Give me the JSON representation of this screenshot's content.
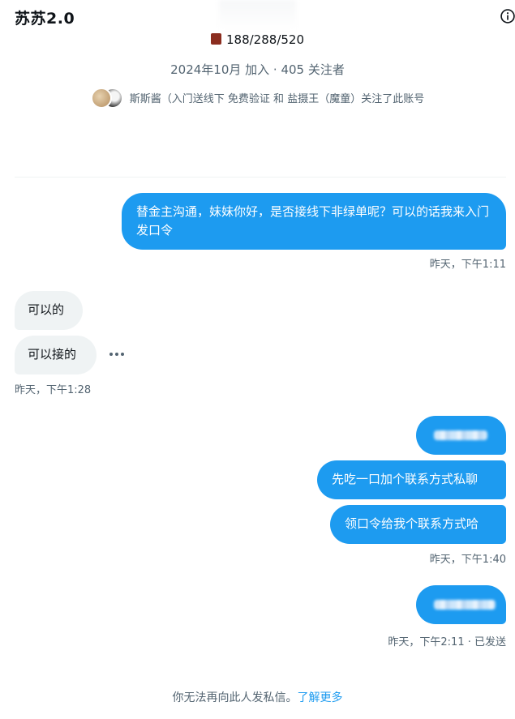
{
  "header": {
    "title": "苏苏2.0",
    "info_icon": "info-circle-icon"
  },
  "profile": {
    "stats": "188/288/520",
    "joined_followers": "2024年10月 加入 · 405 关注者",
    "followed_by": "斯斯酱（入门送线下 免费验证 和 盐摄王（魔童）关注了此账号"
  },
  "messages": {
    "m1_text": "替金主沟通，妹妹你好，是否接线下非绿单呢？可以的话我来入门发口令",
    "m1_time": "昨天，下午1:11",
    "r1_text": "可以的",
    "r2_text": "可以接的",
    "r_time": "昨天，下午1:28",
    "m3_text": "先吃一口加个联系方式私聊",
    "m4_text": "领口令给我个联系方式哈",
    "m_group_time": "昨天，下午1:40",
    "m5_time": "昨天，下午2:11 · 已发送"
  },
  "footer": {
    "text": "你无法再向此人发私信。",
    "link": "了解更多"
  },
  "colors": {
    "accent": "#1d9bf0",
    "received_bg": "#eff3f4",
    "secondary_text": "#536471"
  }
}
